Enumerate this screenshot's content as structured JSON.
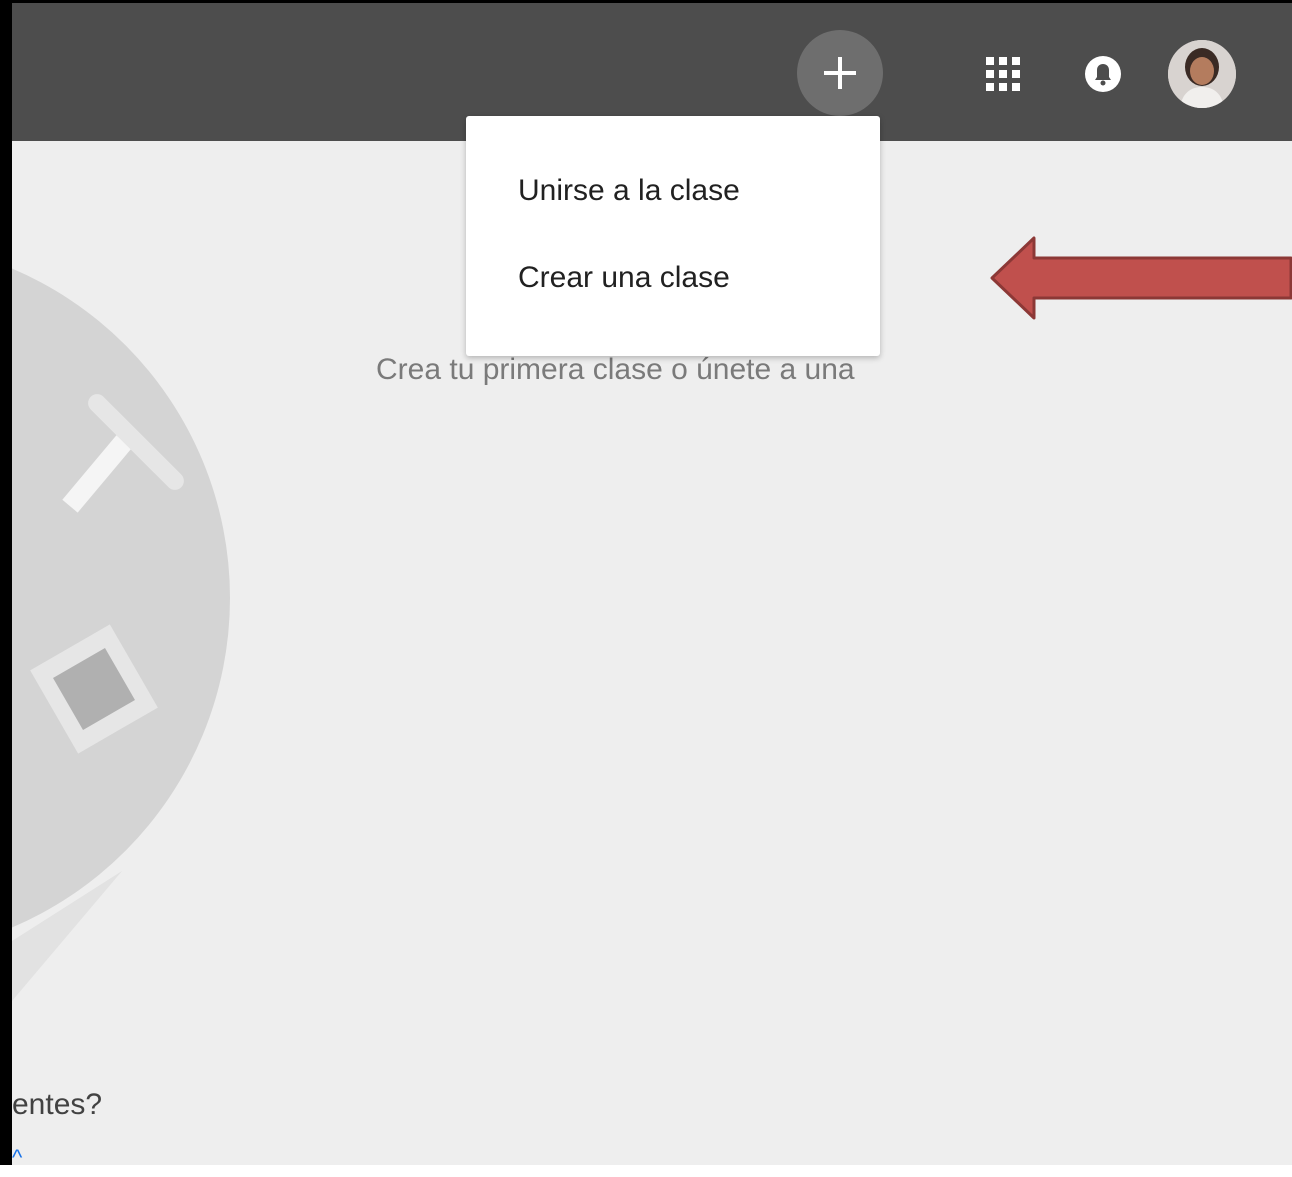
{
  "topbar": {
    "add_button_glyph": "+",
    "add_icon": "plus-icon",
    "apps_icon": "apps-grid-icon",
    "notifications_icon": "bell-icon",
    "avatar_icon": "user-avatar"
  },
  "menu": {
    "items": [
      {
        "label": "Unirse a la clase"
      },
      {
        "label": "Crear una clase"
      }
    ]
  },
  "main": {
    "empty_message": "Crea tu primera clase o únete a una",
    "help_text_fragment": "entes?",
    "help_link_fragment": "^"
  },
  "colors": {
    "topbar": "#4d4d4d",
    "background": "#eeeeee",
    "menu": "#ffffff",
    "annotation_arrow": "#c0504d"
  }
}
